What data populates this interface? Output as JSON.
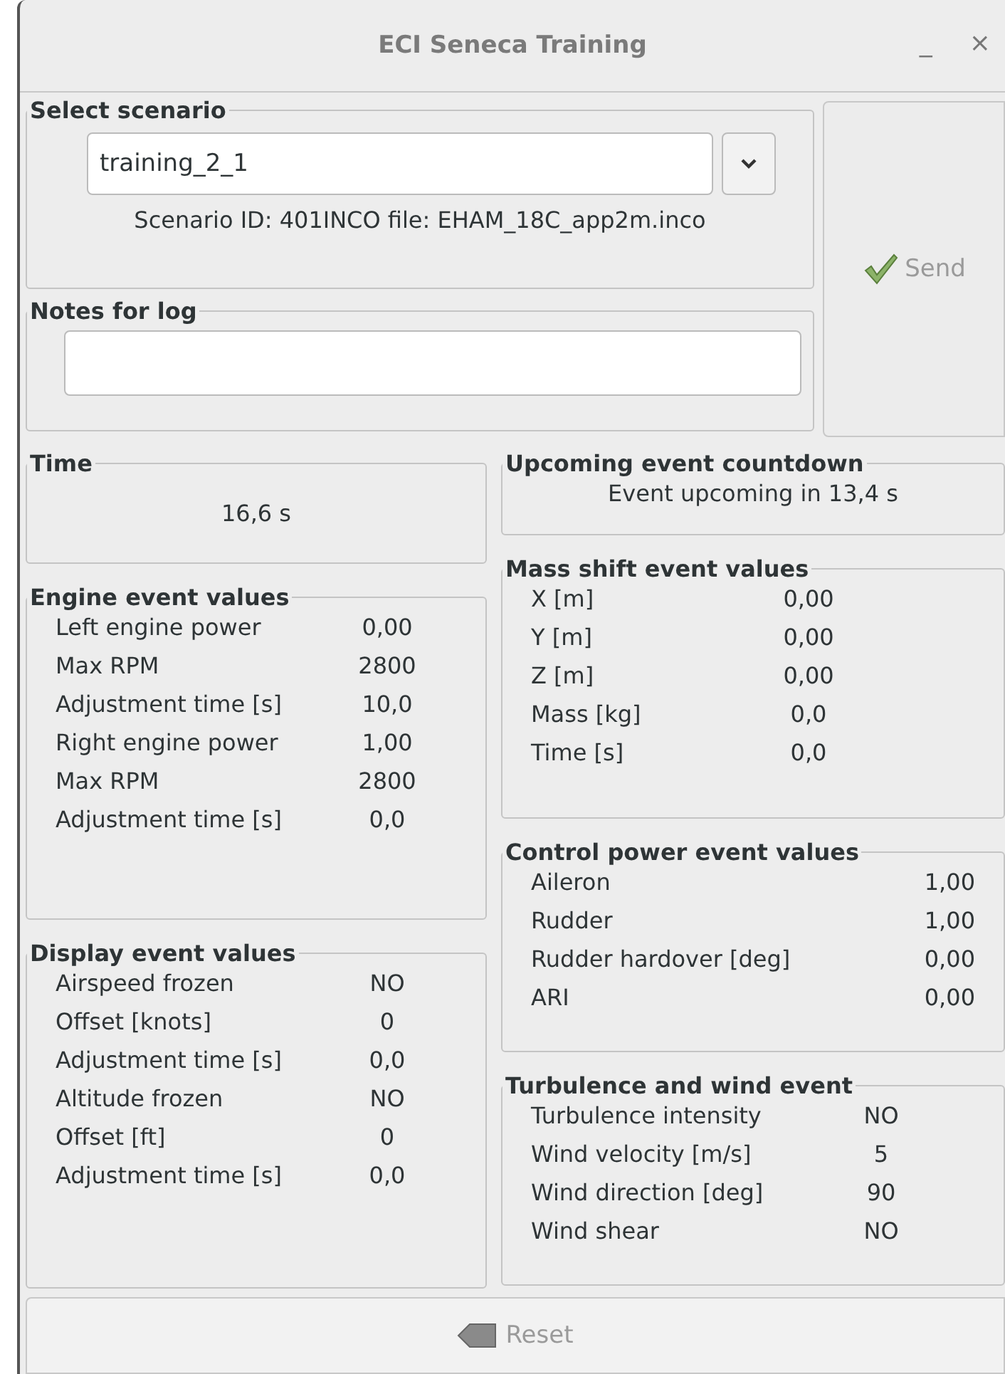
{
  "window": {
    "title": "ECI Seneca Training",
    "controls": [
      "_",
      "×"
    ]
  },
  "scenario": {
    "legend": "Select scenario",
    "value": "training_2_1",
    "info": "Scenario ID: 401INCO file: EHAM_18C_app2m.inco"
  },
  "notes": {
    "legend": "Notes for log"
  },
  "send_button": {
    "label": "Send",
    "disabled": true
  },
  "time": {
    "legend": "Time",
    "value": "16,6 s"
  },
  "countdown": {
    "legend": "Upcoming event countdown",
    "value": "Event upcoming in 13,4 s"
  },
  "left_groups": [
    {
      "legend": "Engine event values",
      "rows": [
        {
          "label": "Left engine power",
          "value": "0,00"
        },
        {
          "label": "Max RPM",
          "value": "2800"
        },
        {
          "label": "Adjustment time [s]",
          "value": "10,0"
        },
        {
          "label": "Right engine power",
          "value": "1,00"
        },
        {
          "label": "Max RPM",
          "value": "2800"
        },
        {
          "label": "Adjustment time [s]",
          "value": "0,0"
        }
      ]
    },
    {
      "legend": "Display event values",
      "rows": [
        {
          "label": "Airspeed frozen",
          "value": "NO"
        },
        {
          "label": "Offset [knots]",
          "value": "0"
        },
        {
          "label": "Adjustment time [s]",
          "value": "0,0"
        },
        {
          "label": "Altitude frozen",
          "value": "NO"
        },
        {
          "label": "Offset [ft]",
          "value": "0"
        },
        {
          "label": "Adjustment time [s]",
          "value": "0,0"
        }
      ]
    }
  ],
  "right_groups": [
    {
      "legend": "Mass shift event values",
      "rows": [
        {
          "label": "X [m]",
          "value": "0,00"
        },
        {
          "label": "Y [m]",
          "value": "0,00"
        },
        {
          "label": "Z [m]",
          "value": "0,00"
        },
        {
          "label": "Mass [kg]",
          "value": "0,0"
        },
        {
          "label": "Time [s]",
          "value": "0,0"
        }
      ]
    },
    {
      "legend": "Control power event values",
      "rows": [
        {
          "label": "Aileron",
          "value": "1,00"
        },
        {
          "label": "Rudder",
          "value": "1,00"
        },
        {
          "label": "Rudder hardover [deg]",
          "value": "0,00"
        },
        {
          "label": "ARI",
          "value": "0,00"
        }
      ]
    },
    {
      "legend": "Turbulence and wind event",
      "rows": [
        {
          "label": "Turbulence intensity",
          "value": "NO"
        },
        {
          "label": "Wind velocity [m/s]",
          "value": "5"
        },
        {
          "label": "Wind direction [deg]",
          "value": "90"
        },
        {
          "label": "Wind shear",
          "value": "NO"
        }
      ]
    }
  ],
  "reset_button": {
    "label": "Reset",
    "disabled": true
  }
}
